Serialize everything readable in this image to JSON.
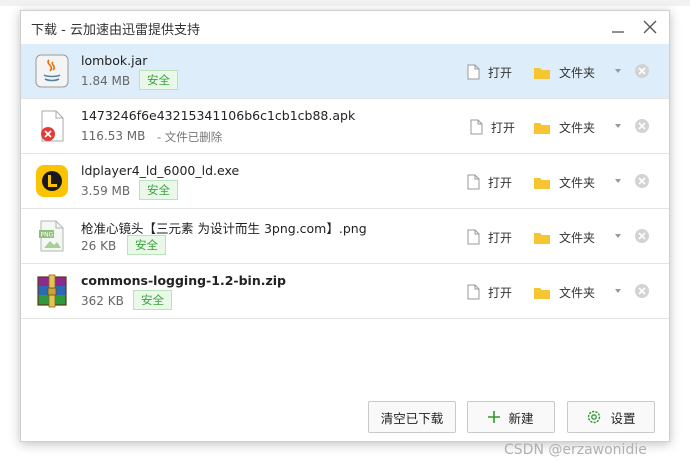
{
  "window": {
    "title": "下载 - 云加速由迅雷提供支持"
  },
  "files": [
    {
      "name": "lombok.jar",
      "size": "1.84 MB",
      "status": "安全",
      "icon": "java-file-icon"
    },
    {
      "name": "1473246f6e43215341106b6c1cb1cb88.apk",
      "size": "116.53 MB",
      "status": "- 文件已删除",
      "icon": "deleted-file-icon"
    },
    {
      "name": "ldplayer4_ld_6000_ld.exe",
      "size": "3.59 MB",
      "status": "安全",
      "icon": "ldplayer-app-icon"
    },
    {
      "name": "枪准心镜头【三元素 为设计而生 3png.com】.png",
      "size": "26 KB",
      "status": "安全",
      "icon": "png-file-icon"
    },
    {
      "name": "commons-logging-1.2-bin.zip",
      "size": "362 KB",
      "status": "安全",
      "icon": "winrar-archive-icon"
    }
  ],
  "actions": {
    "open": "打开",
    "folder": "文件夹"
  },
  "footer": {
    "clear": "清空已下载",
    "new": "新建",
    "settings": "设置"
  },
  "watermark": "CSDN @erzawonidie",
  "colors": {
    "selected_row": "#ddeefa",
    "safe_text": "#3aa23a",
    "folder": "#f7c531"
  }
}
